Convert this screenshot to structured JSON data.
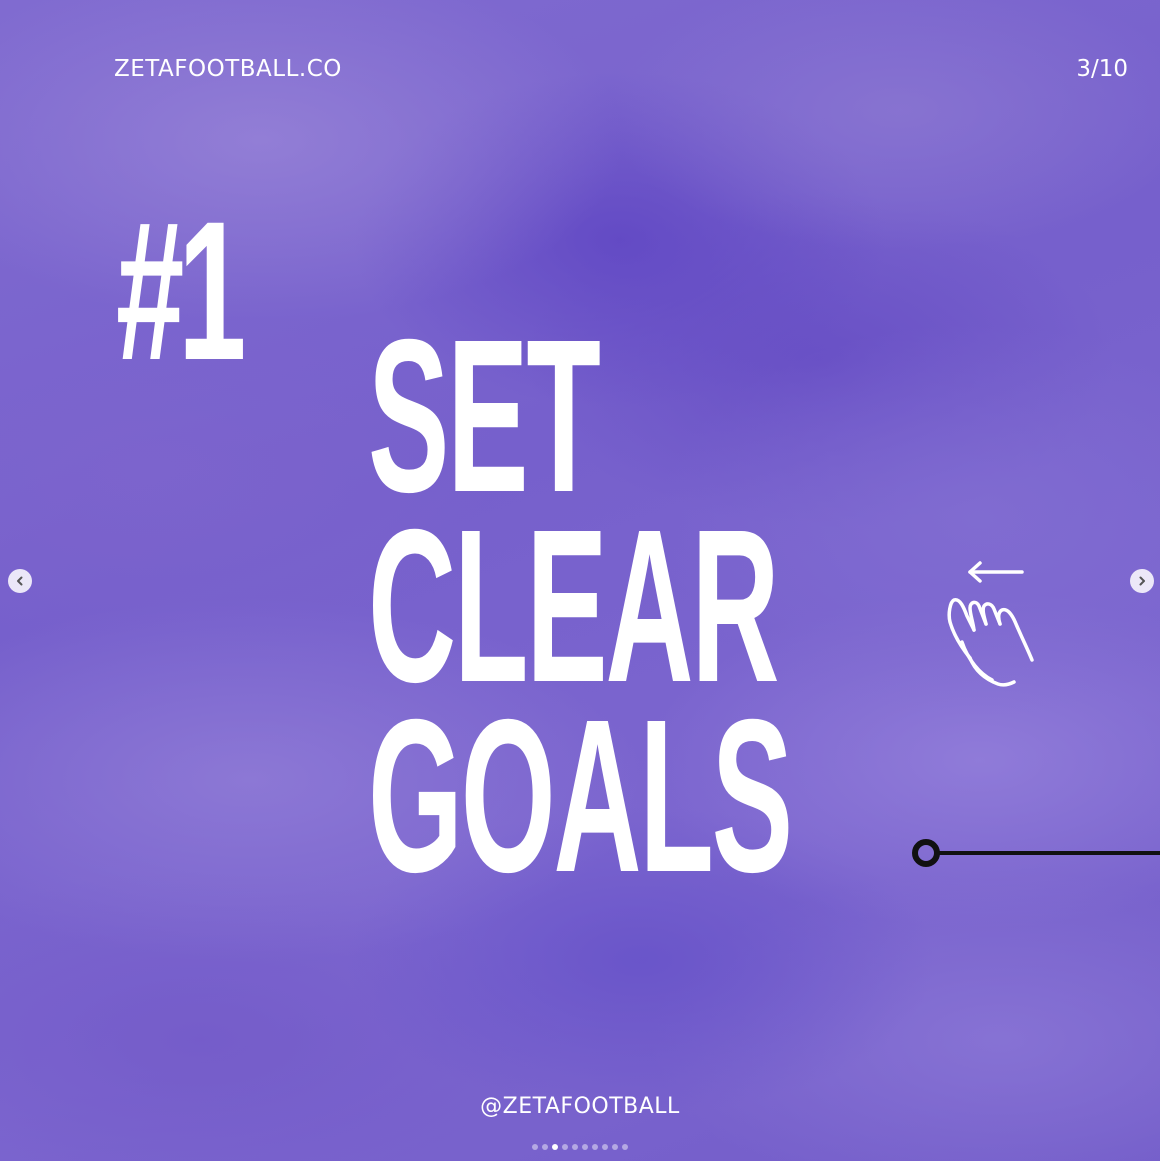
{
  "header": {
    "brand": "ZETAFOOTBALL.CO",
    "counter": "3/10"
  },
  "content": {
    "number": "#1",
    "headline_lines": [
      "SET",
      "CLEAR",
      "GOALS"
    ]
  },
  "footer": {
    "handle": "@ZETAFOOTBALL"
  },
  "carousel": {
    "current_index": 2,
    "total_dots": 10,
    "prev_icon": "chevron-left-icon",
    "next_icon": "chevron-right-icon"
  },
  "decor": {
    "swipe_icon": "swipe-left-hand-icon",
    "line_icon": "circle-line-icon"
  },
  "colors": {
    "background": "#7a63cc",
    "text": "#ffffff",
    "line": "#111111"
  }
}
